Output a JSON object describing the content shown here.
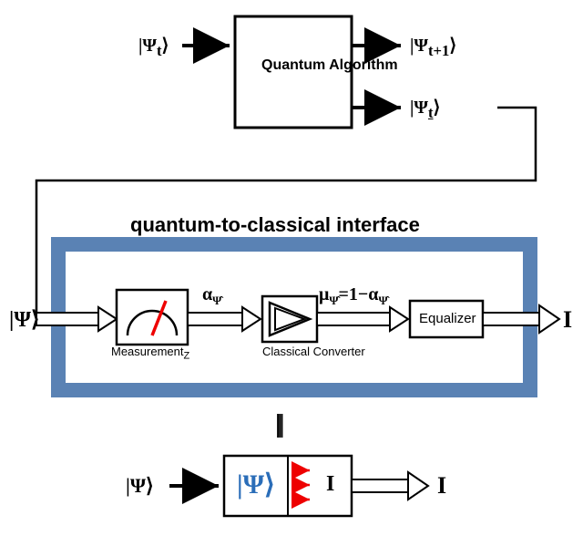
{
  "top": {
    "input": "|Ψ",
    "input_sub": "t",
    "block": "Quantum Algorithm",
    "out1": "|Ψ",
    "out1_sub": "t+1",
    "out2": "|Ψ",
    "out2_sub": "t",
    "out2_under": "_"
  },
  "iface_title": "quantum-to-classical interface",
  "iface": {
    "in": "|Ψ⟩",
    "meas": "Measurement",
    "meas_sub": "Z",
    "alpha": "α",
    "alpha_sub": "Ψ̂",
    "conv": "Classical Converter",
    "mu": "μ",
    "mu_sub": "Ψ̂",
    "mu_eq": "=1−α",
    "mu_sub2": "Ψ̂",
    "eq": "Equalizer",
    "out": "I"
  },
  "equiv": "|||",
  "bottom": {
    "in": "|Ψ⟩",
    "ket": "|Ψ⟩",
    "out_inner": "I",
    "out": "I"
  }
}
